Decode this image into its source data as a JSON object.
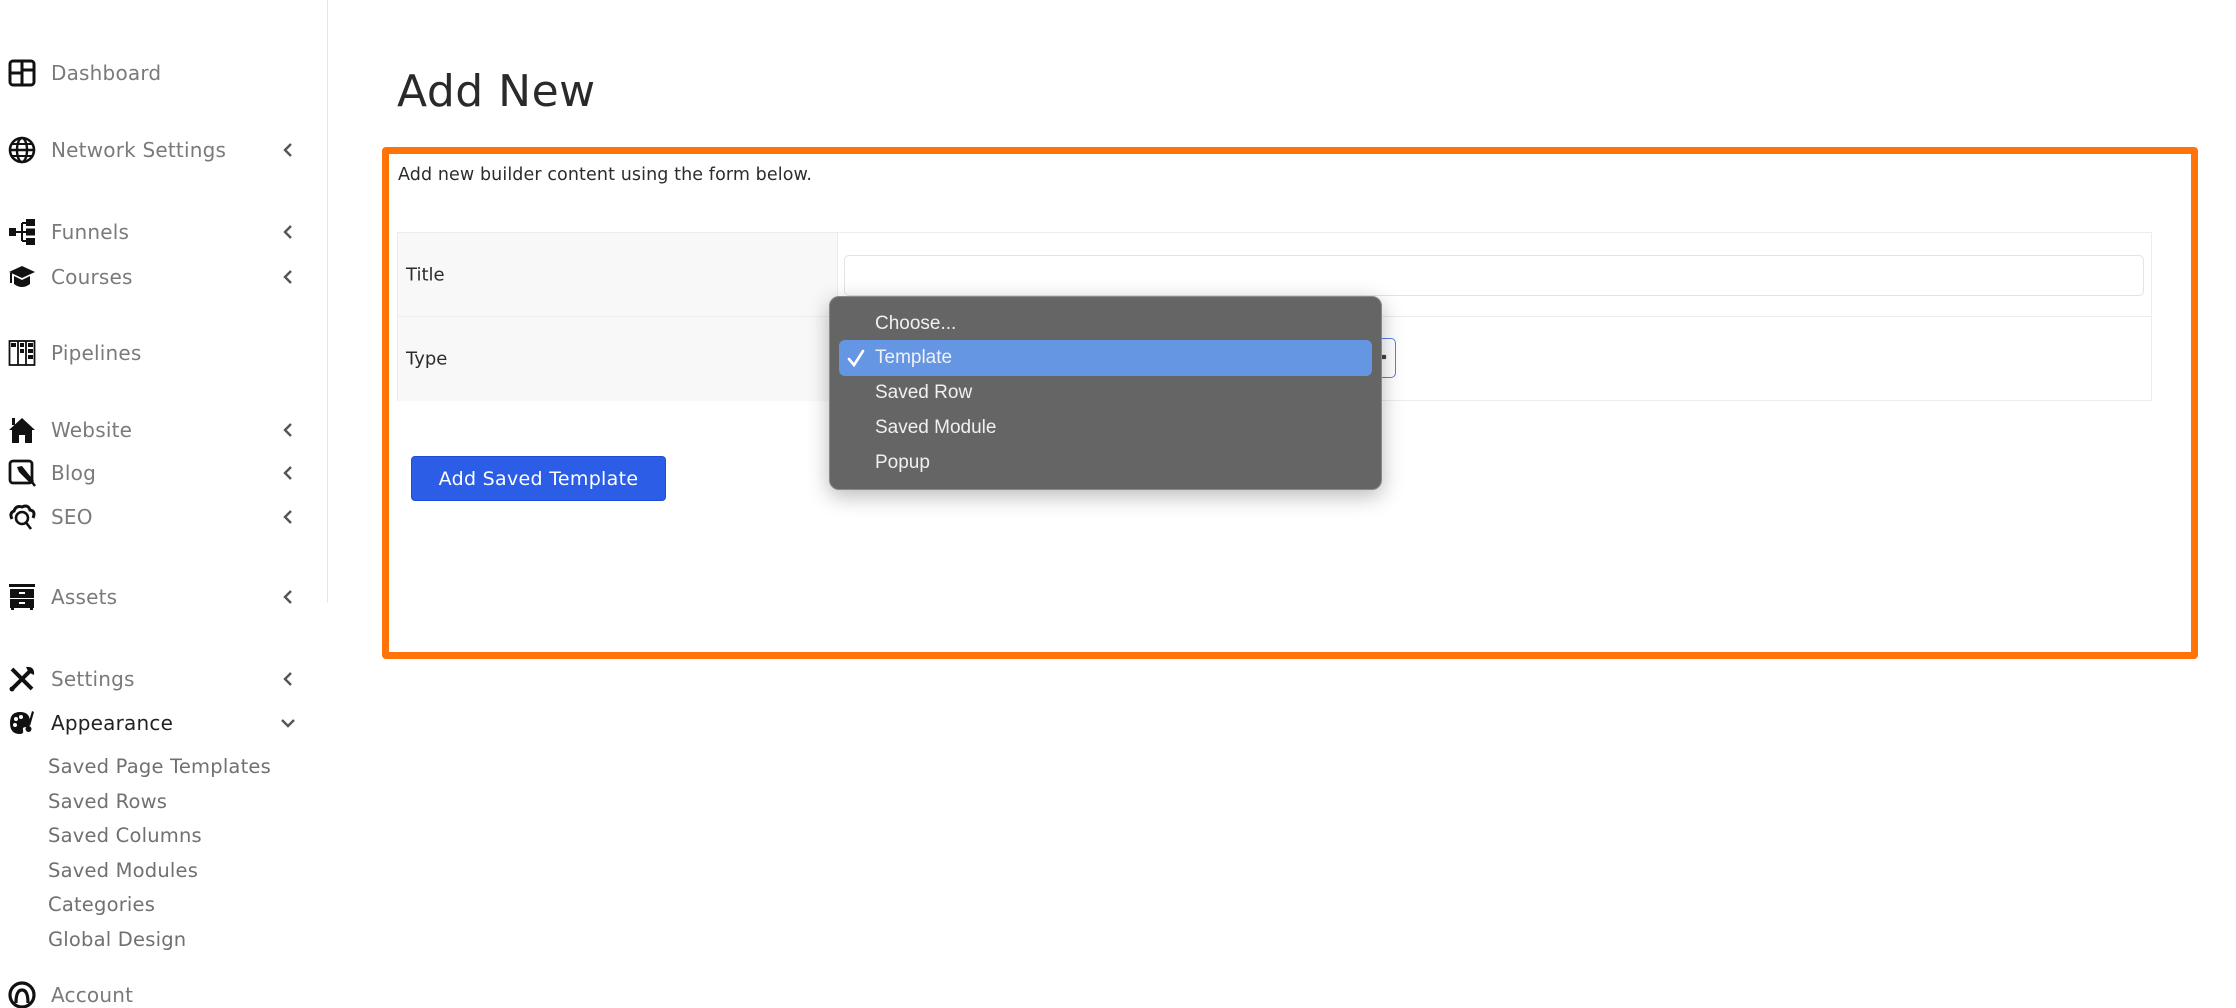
{
  "sidebar": {
    "items": [
      {
        "label": "Dashboard",
        "icon": "dashboard-grid-icon",
        "has_chevron": false
      },
      {
        "label": "Network Settings",
        "icon": "globe-icon",
        "has_chevron": true
      },
      {
        "label": "Funnels",
        "icon": "sitemap-icon",
        "has_chevron": true
      },
      {
        "label": "Courses",
        "icon": "graduation-cap-icon",
        "has_chevron": true
      },
      {
        "label": "Pipelines",
        "icon": "kanban-board-icon",
        "has_chevron": false
      },
      {
        "label": "Website",
        "icon": "house-icon",
        "has_chevron": true
      },
      {
        "label": "Blog",
        "icon": "pen-square-icon",
        "has_chevron": true
      },
      {
        "label": "SEO",
        "icon": "cloud-search-icon",
        "has_chevron": true
      },
      {
        "label": "Assets",
        "icon": "drawer-cabinet-icon",
        "has_chevron": true
      },
      {
        "label": "Settings",
        "icon": "tools-icon",
        "has_chevron": true
      },
      {
        "label": "Appearance",
        "icon": "palette-icon",
        "has_chevron": true,
        "expanded": true
      },
      {
        "label": "Account",
        "icon": "account-circle-icon",
        "has_chevron": false
      }
    ],
    "appearance_submenu": [
      "Saved Page Templates",
      "Saved Rows",
      "Saved Columns",
      "Saved Modules",
      "Categories",
      "Global Design"
    ]
  },
  "main": {
    "title": "Add New",
    "description": "Add new builder content using the form below.",
    "form": {
      "title_label": "Title",
      "title_value": "",
      "type_label": "Type",
      "type_selected": "Template"
    },
    "submit_label": "Add Saved Template"
  },
  "dropdown": {
    "options": [
      "Choose...",
      "Template",
      "Saved Row",
      "Saved Module",
      "Popup"
    ],
    "selected_index": 1
  },
  "colors": {
    "highlight_border": "#ff7308",
    "primary_button": "#2b5de6",
    "dropdown_selected": "#6596e3",
    "dropdown_background": "#656565"
  }
}
